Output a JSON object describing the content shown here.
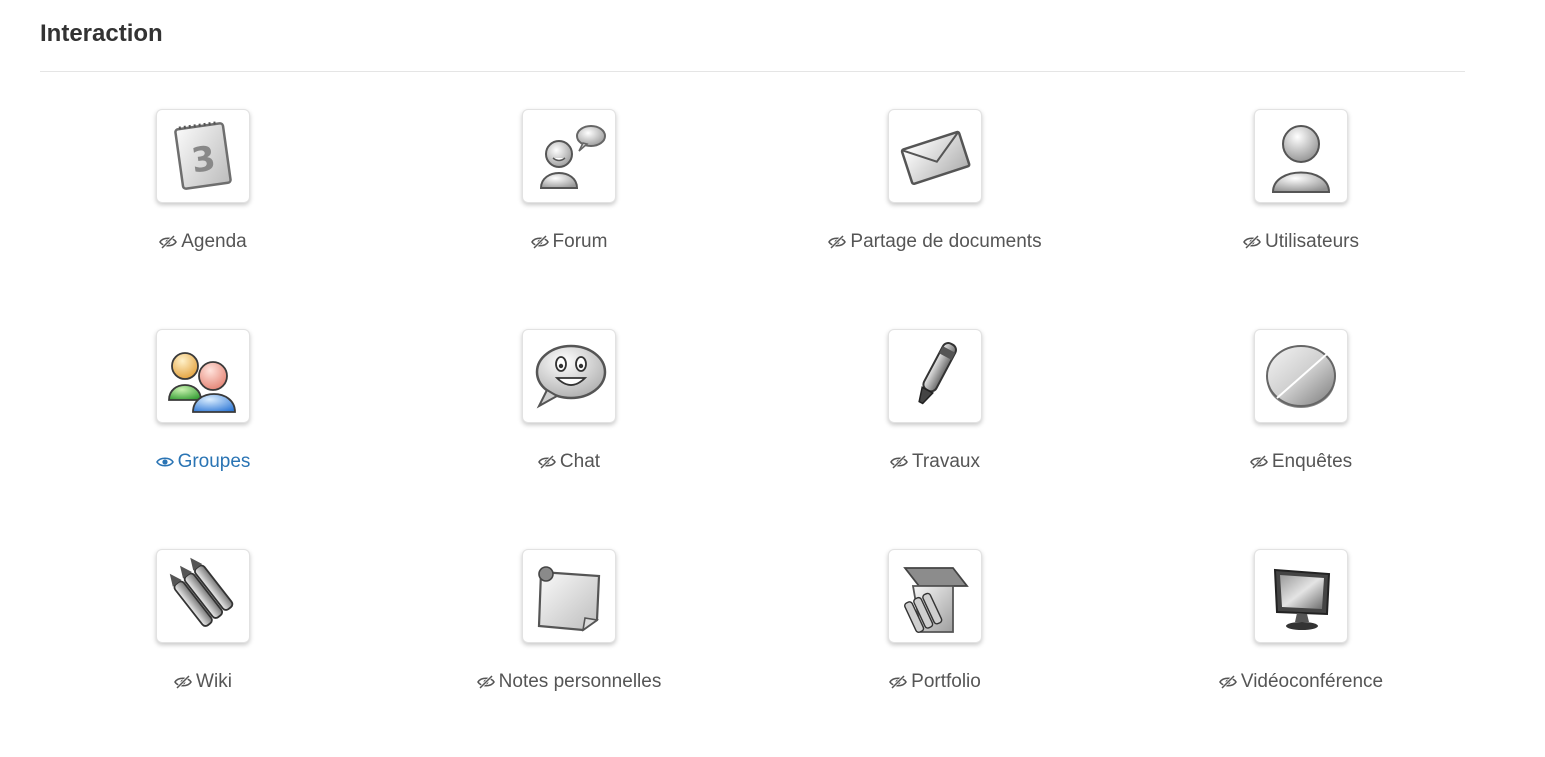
{
  "section": {
    "title": "Interaction"
  },
  "colors": {
    "text": "#555555",
    "link_active": "#2a74b4",
    "divider": "#e5e5e5"
  },
  "tools": [
    {
      "name": "Agenda",
      "icon": "calendar-icon",
      "state": "hidden"
    },
    {
      "name": "Forum",
      "icon": "forum-user-speech-icon",
      "state": "hidden"
    },
    {
      "name": "Partage de documents",
      "icon": "envelope-icon",
      "state": "hidden"
    },
    {
      "name": "Utilisateurs",
      "icon": "user-icon",
      "state": "hidden"
    },
    {
      "name": "Groupes",
      "icon": "group-users-icon",
      "state": "visible"
    },
    {
      "name": "Chat",
      "icon": "smiley-speech-bubble-icon",
      "state": "hidden"
    },
    {
      "name": "Travaux",
      "icon": "marker-pen-icon",
      "state": "hidden"
    },
    {
      "name": "Enquêtes",
      "icon": "pie-chart-icon",
      "state": "hidden"
    },
    {
      "name": "Wiki",
      "icon": "pencils-icon",
      "state": "hidden"
    },
    {
      "name": "Notes personnelles",
      "icon": "sticky-note-icon",
      "state": "hidden"
    },
    {
      "name": "Portfolio",
      "icon": "portfolio-icon",
      "state": "hidden"
    },
    {
      "name": "Vidéoconférence",
      "icon": "monitor-icon",
      "state": "hidden"
    }
  ]
}
